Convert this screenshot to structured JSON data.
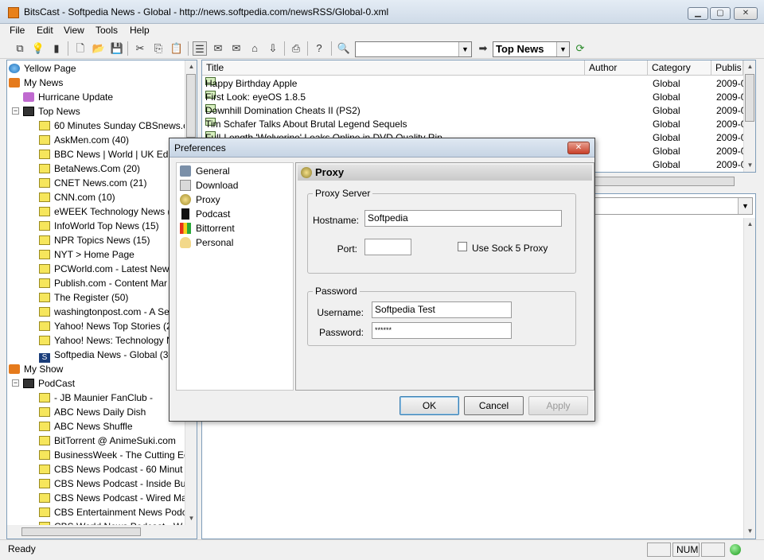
{
  "window": {
    "title": "BitsCast - Softpedia News - Global - http://news.softpedia.com/newsRSS/Global-0.xml"
  },
  "menu": [
    "File",
    "Edit",
    "View",
    "Tools",
    "Help"
  ],
  "toolbar": {
    "search_placeholder": "",
    "channel_select": "Top News"
  },
  "tree": {
    "items": [
      {
        "label": "Yellow Page",
        "icon": "globe-icon",
        "indent": 0
      },
      {
        "label": "My News",
        "icon": "rss-icon",
        "indent": 0
      },
      {
        "label": "Hurricane Update",
        "icon": "hurricane-icon",
        "indent": 1
      },
      {
        "label": "Top News",
        "icon": "computer-icon",
        "indent": 1
      },
      {
        "label": "60 Minutes Sunday CBSnews.c",
        "icon": "folder-icon",
        "indent": 2
      },
      {
        "label": "AskMen.com (40)",
        "icon": "folder-icon",
        "indent": 2
      },
      {
        "label": "BBC News | World | UK Editi",
        "icon": "folder-icon",
        "indent": 2
      },
      {
        "label": "BetaNews.Com (20)",
        "icon": "folder-icon",
        "indent": 2
      },
      {
        "label": "CNET News.com (21)",
        "icon": "folder-icon",
        "indent": 2
      },
      {
        "label": "CNN.com (10)",
        "icon": "folder-icon",
        "indent": 2
      },
      {
        "label": "eWEEK Technology News (",
        "icon": "folder-icon",
        "indent": 2
      },
      {
        "label": "InfoWorld Top News (15)",
        "icon": "folder-icon",
        "indent": 2
      },
      {
        "label": "NPR Topics News (15)",
        "icon": "folder-icon",
        "indent": 2
      },
      {
        "label": "NYT > Home Page",
        "icon": "folder-icon",
        "indent": 2
      },
      {
        "label": "PCWorld.com - Latest New",
        "icon": "folder-icon",
        "indent": 2
      },
      {
        "label": "Publish.com - Content Mar",
        "icon": "folder-icon",
        "indent": 2
      },
      {
        "label": "The Register (50)",
        "icon": "folder-icon",
        "indent": 2
      },
      {
        "label": "washingtonpost.com - A Se",
        "icon": "folder-icon",
        "indent": 2
      },
      {
        "label": "Yahoo! News Top Stories (2",
        "icon": "folder-icon",
        "indent": 2
      },
      {
        "label": "Yahoo! News: Technology N",
        "icon": "folder-icon",
        "indent": 2
      },
      {
        "label": "Softpedia News - Global (30",
        "icon": "softpedia-icon",
        "indent": 2
      },
      {
        "label": "My Show",
        "icon": "rss-icon",
        "indent": 0
      },
      {
        "label": "PodCast",
        "icon": "computer-icon",
        "indent": 1
      },
      {
        "label": "- JB Maunier FanClub -",
        "icon": "folder-icon",
        "indent": 2
      },
      {
        "label": "ABC News Daily Dish",
        "icon": "folder-icon",
        "indent": 2
      },
      {
        "label": "ABC News Shuffle",
        "icon": "folder-icon",
        "indent": 2
      },
      {
        "label": "BitTorrent @ AnimeSuki.com",
        "icon": "folder-icon",
        "indent": 2
      },
      {
        "label": "BusinessWeek - The Cutting Ec",
        "icon": "folder-icon",
        "indent": 2
      },
      {
        "label": "CBS  News Podcast - 60 Minut",
        "icon": "folder-icon",
        "indent": 2
      },
      {
        "label": "CBS  News Podcast - Inside Bu",
        "icon": "folder-icon",
        "indent": 2
      },
      {
        "label": "CBS  News Podcast - Wired Ma",
        "icon": "folder-icon",
        "indent": 2
      },
      {
        "label": "CBS Entertainment News Podc",
        "icon": "folder-icon",
        "indent": 2
      },
      {
        "label": "CBS World News Podcast - W",
        "icon": "folder-icon",
        "indent": 2
      }
    ]
  },
  "list": {
    "columns": [
      "Title",
      "Author",
      "Category",
      "Publis"
    ],
    "rows": [
      {
        "title": "Happy Birthday Apple",
        "author": "",
        "category": "Global",
        "date": "2009-0"
      },
      {
        "title": "First Look: eyeOS 1.8.5",
        "author": "",
        "category": "Global",
        "date": "2009-0"
      },
      {
        "title": "Downhill Domination Cheats II (PS2)",
        "author": "",
        "category": "Global",
        "date": "2009-0"
      },
      {
        "title": "Tim Schafer Talks About Brutal Legend Sequels",
        "author": "",
        "category": "Global",
        "date": "2009-0"
      },
      {
        "title": "Full-Length 'Wolverine' Leaks Online in DVD Quality Rip",
        "author": "",
        "category": "Global",
        "date": "2009-0"
      },
      {
        "title": "",
        "author": "",
        "category": "Global",
        "date": "2009-0"
      },
      {
        "title": "",
        "author": "",
        "category": "Global",
        "date": "2009-0"
      }
    ]
  },
  "status": {
    "text": "Ready",
    "num": "NUM"
  },
  "dialog": {
    "title": "Preferences",
    "categories": [
      "General",
      "Download",
      "Proxy",
      "Podcast",
      "Bittorrent",
      "Personal"
    ],
    "panel_title": "Proxy",
    "proxy_group": "Proxy Server",
    "hostname_label": "Hostname:",
    "hostname_value": "Softpedia",
    "port_label": "Port:",
    "port_value": "",
    "sock5_label": "Use Sock 5 Proxy",
    "password_group": "Password",
    "username_label": "Username:",
    "username_value": "Softpedia Test",
    "password_label": "Password:",
    "password_value": "******",
    "ok": "OK",
    "cancel": "Cancel",
    "apply": "Apply"
  }
}
